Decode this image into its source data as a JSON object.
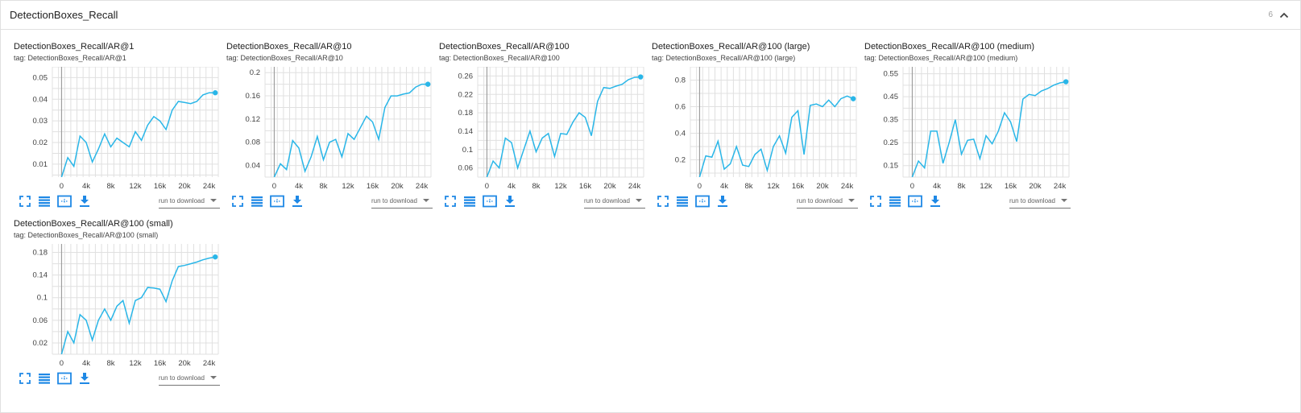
{
  "section": {
    "title": "DetectionBoxes_Recall",
    "count": "6",
    "collapse_icon": "chevron-up-icon"
  },
  "toolbar_icons": [
    "fullscreen-icon",
    "list-icon",
    "fit-domain-icon",
    "download-icon"
  ],
  "colors": {
    "series": "#29b6e8",
    "accent": "#1e88e5",
    "axis": "#9e9e9e",
    "grid": "#e0e0e0"
  },
  "cards": [
    {
      "title": "DetectionBoxes_Recall/AR@1",
      "tag": "tag: DetectionBoxes_Recall/AR@1",
      "select": "run to download",
      "chart_data": {
        "type": "line",
        "x": [
          0,
          1000,
          2000,
          3000,
          4000,
          5000,
          6000,
          7000,
          8000,
          9000,
          10000,
          11000,
          12000,
          13000,
          14000,
          15000,
          16000,
          17000,
          18000,
          19000,
          20000,
          21000,
          22000,
          23000,
          24000,
          25000
        ],
        "y": [
          0.004,
          0.013,
          0.009,
          0.023,
          0.02,
          0.011,
          0.017,
          0.024,
          0.018,
          0.022,
          0.02,
          0.018,
          0.025,
          0.021,
          0.028,
          0.032,
          0.03,
          0.026,
          0.035,
          0.039,
          0.0385,
          0.038,
          0.039,
          0.042,
          0.043,
          0.043
        ],
        "xlim": [
          -1500,
          25500
        ],
        "ylim": [
          0.004,
          0.055
        ],
        "xticks": [
          0,
          4000,
          8000,
          12000,
          16000,
          20000,
          24000
        ],
        "xtick_labels": [
          "0",
          "4k",
          "8k",
          "12k",
          "16k",
          "20k",
          "24k"
        ],
        "yticks": [
          0.01,
          0.02,
          0.03,
          0.04,
          0.05
        ],
        "ytick_labels": [
          "0.01",
          "0.02",
          "0.03",
          "0.04",
          "0.05"
        ],
        "grid": true
      }
    },
    {
      "title": "DetectionBoxes_Recall/AR@10",
      "tag": "tag: DetectionBoxes_Recall/AR@10",
      "select": "run to download",
      "chart_data": {
        "type": "line",
        "x": [
          0,
          1000,
          2000,
          3000,
          4000,
          5000,
          6000,
          7000,
          8000,
          9000,
          10000,
          11000,
          12000,
          13000,
          14000,
          15000,
          16000,
          17000,
          18000,
          19000,
          20000,
          21000,
          22000,
          23000,
          24000,
          25000
        ],
        "y": [
          0.02,
          0.043,
          0.033,
          0.083,
          0.07,
          0.03,
          0.055,
          0.09,
          0.05,
          0.08,
          0.085,
          0.055,
          0.095,
          0.085,
          0.105,
          0.125,
          0.115,
          0.085,
          0.14,
          0.16,
          0.16,
          0.163,
          0.165,
          0.175,
          0.18,
          0.18
        ],
        "xlim": [
          -1500,
          25500
        ],
        "ylim": [
          0.02,
          0.21
        ],
        "xticks": [
          0,
          4000,
          8000,
          12000,
          16000,
          20000,
          24000
        ],
        "xtick_labels": [
          "0",
          "4k",
          "8k",
          "12k",
          "16k",
          "20k",
          "24k"
        ],
        "yticks": [
          0.04,
          0.08,
          0.12,
          0.16,
          0.2
        ],
        "ytick_labels": [
          "0.04",
          "0.08",
          "0.12",
          "0.16",
          "0.2"
        ],
        "grid": true
      }
    },
    {
      "title": "DetectionBoxes_Recall/AR@100",
      "tag": "tag: DetectionBoxes_Recall/AR@100",
      "select": "run to download",
      "chart_data": {
        "type": "line",
        "x": [
          0,
          1000,
          2000,
          3000,
          4000,
          5000,
          6000,
          7000,
          8000,
          9000,
          10000,
          11000,
          12000,
          13000,
          14000,
          15000,
          16000,
          17000,
          18000,
          19000,
          20000,
          21000,
          22000,
          23000,
          24000,
          25000
        ],
        "y": [
          0.04,
          0.075,
          0.06,
          0.125,
          0.115,
          0.06,
          0.1,
          0.14,
          0.095,
          0.125,
          0.135,
          0.085,
          0.135,
          0.133,
          0.16,
          0.18,
          0.17,
          0.13,
          0.205,
          0.235,
          0.233,
          0.238,
          0.242,
          0.252,
          0.257,
          0.258
        ],
        "xlim": [
          -1500,
          25500
        ],
        "ylim": [
          0.04,
          0.28
        ],
        "xticks": [
          0,
          4000,
          8000,
          12000,
          16000,
          20000,
          24000
        ],
        "xtick_labels": [
          "0",
          "4k",
          "8k",
          "12k",
          "16k",
          "20k",
          "24k"
        ],
        "yticks": [
          0.06,
          0.1,
          0.14,
          0.18,
          0.22,
          0.26
        ],
        "ytick_labels": [
          "0.06",
          "0.1",
          "0.14",
          "0.18",
          "0.22",
          "0.26"
        ],
        "grid": true
      }
    },
    {
      "title": "DetectionBoxes_Recall/AR@100 (large)",
      "tag": "tag: DetectionBoxes_Recall/AR@100 (large)",
      "select": "run to download",
      "chart_data": {
        "type": "line",
        "x": [
          0,
          1000,
          2000,
          3000,
          4000,
          5000,
          6000,
          7000,
          8000,
          9000,
          10000,
          11000,
          12000,
          13000,
          14000,
          15000,
          16000,
          17000,
          18000,
          19000,
          20000,
          21000,
          22000,
          23000,
          24000,
          25000
        ],
        "y": [
          0.07,
          0.23,
          0.22,
          0.34,
          0.13,
          0.17,
          0.3,
          0.16,
          0.15,
          0.24,
          0.28,
          0.12,
          0.3,
          0.38,
          0.25,
          0.52,
          0.57,
          0.24,
          0.61,
          0.62,
          0.6,
          0.65,
          0.6,
          0.66,
          0.68,
          0.66
        ],
        "xlim": [
          -1500,
          25500
        ],
        "ylim": [
          0.07,
          0.9
        ],
        "xticks": [
          0,
          4000,
          8000,
          12000,
          16000,
          20000,
          24000
        ],
        "xtick_labels": [
          "0",
          "4k",
          "8k",
          "12k",
          "16k",
          "20k",
          "24k"
        ],
        "yticks": [
          0.2,
          0.4,
          0.6,
          0.8
        ],
        "ytick_labels": [
          "0.2",
          "0.4",
          "0.6",
          "0.8"
        ],
        "grid": true
      }
    },
    {
      "title": "DetectionBoxes_Recall/AR@100 (medium)",
      "tag": "tag: DetectionBoxes_Recall/AR@100 (medium)",
      "select": "run to download",
      "chart_data": {
        "type": "line",
        "x": [
          0,
          1000,
          2000,
          3000,
          4000,
          5000,
          6000,
          7000,
          8000,
          9000,
          10000,
          11000,
          12000,
          13000,
          14000,
          15000,
          16000,
          17000,
          18000,
          19000,
          20000,
          21000,
          22000,
          23000,
          24000,
          25000
        ],
        "y": [
          0.1,
          0.17,
          0.14,
          0.3,
          0.3,
          0.16,
          0.25,
          0.35,
          0.2,
          0.26,
          0.265,
          0.18,
          0.28,
          0.245,
          0.3,
          0.38,
          0.34,
          0.255,
          0.44,
          0.46,
          0.455,
          0.475,
          0.485,
          0.5,
          0.51,
          0.515
        ],
        "xlim": [
          -1500,
          25500
        ],
        "ylim": [
          0.1,
          0.58
        ],
        "xticks": [
          0,
          4000,
          8000,
          12000,
          16000,
          20000,
          24000
        ],
        "xtick_labels": [
          "0",
          "4k",
          "8k",
          "12k",
          "16k",
          "20k",
          "24k"
        ],
        "yticks": [
          0.15,
          0.25,
          0.35,
          0.45,
          0.55
        ],
        "ytick_labels": [
          "0.15",
          "0.25",
          "0.35",
          "0.45",
          "0.55"
        ],
        "grid": true
      }
    },
    {
      "title": "DetectionBoxes_Recall/AR@100 (small)",
      "tag": "tag: DetectionBoxes_Recall/AR@100 (small)",
      "select": "run to download",
      "chart_data": {
        "type": "line",
        "x": [
          0,
          1000,
          2000,
          3000,
          4000,
          5000,
          6000,
          7000,
          8000,
          9000,
          10000,
          11000,
          12000,
          13000,
          14000,
          15000,
          16000,
          17000,
          18000,
          19000,
          20000,
          21000,
          22000,
          23000,
          24000,
          25000
        ],
        "y": [
          0.0,
          0.04,
          0.02,
          0.07,
          0.06,
          0.025,
          0.06,
          0.08,
          0.06,
          0.085,
          0.095,
          0.055,
          0.095,
          0.1,
          0.118,
          0.117,
          0.115,
          0.093,
          0.13,
          0.155,
          0.157,
          0.16,
          0.163,
          0.167,
          0.17,
          0.172
        ],
        "xlim": [
          -1500,
          25500
        ],
        "ylim": [
          0.0,
          0.195
        ],
        "xticks": [
          0,
          4000,
          8000,
          12000,
          16000,
          20000,
          24000
        ],
        "xtick_labels": [
          "0",
          "4k",
          "8k",
          "12k",
          "16k",
          "20k",
          "24k"
        ],
        "yticks": [
          0.02,
          0.06,
          0.1,
          0.14,
          0.18
        ],
        "ytick_labels": [
          "0.02",
          "0.06",
          "0.1",
          "0.14",
          "0.18"
        ],
        "grid": true
      }
    }
  ]
}
